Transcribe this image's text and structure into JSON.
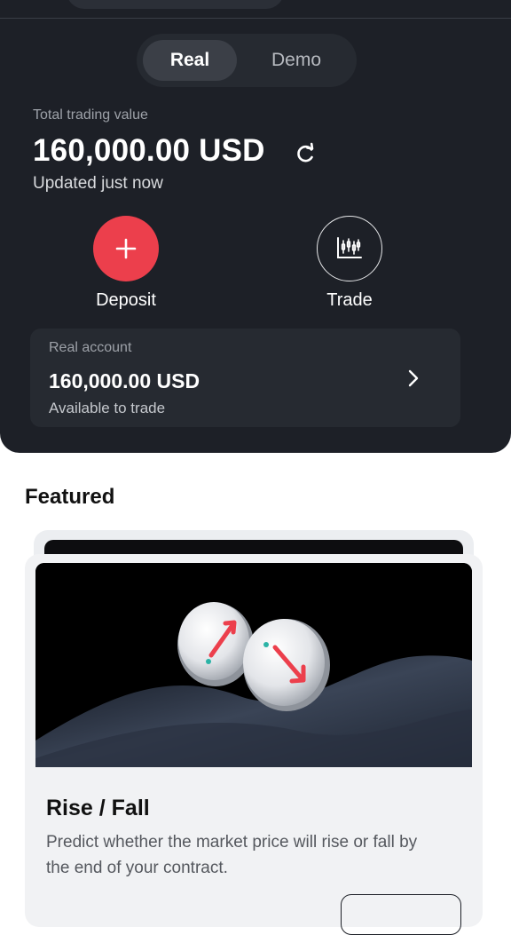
{
  "account_toggle": {
    "real": "Real",
    "demo": "Demo",
    "selected": "Real"
  },
  "summary": {
    "label": "Total trading value",
    "value": "160,000.00 USD",
    "updated": "Updated just now"
  },
  "actions": {
    "deposit": "Deposit",
    "trade": "Trade"
  },
  "account_card": {
    "label": "Real account",
    "value": "160,000.00 USD",
    "sub": "Available to trade"
  },
  "featured": {
    "heading": "Featured",
    "card": {
      "title": "Rise / Fall",
      "description": "Predict whether the market price will rise or fall by the end of your contract."
    }
  },
  "colors": {
    "panel": "#1d2027",
    "accent": "#ec3f4c",
    "teal": "#2bb3a6"
  },
  "icons": {
    "refresh": "refresh-icon",
    "deposit": "plus-icon",
    "trade": "candlestick-chart-icon",
    "account": "chevron-right-icon"
  }
}
